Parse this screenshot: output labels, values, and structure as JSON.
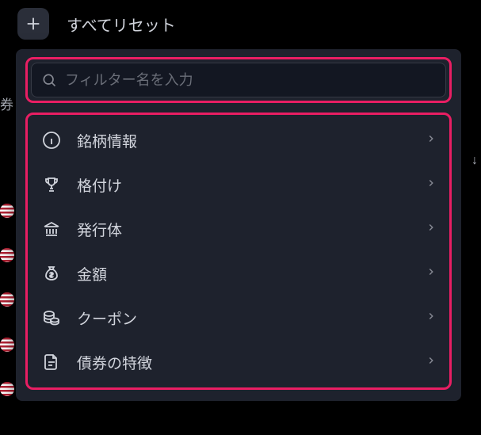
{
  "topbar": {
    "reset_label": "すべてリセット"
  },
  "search": {
    "placeholder": "フィルター名を入力"
  },
  "categories": [
    {
      "icon": "info-icon",
      "label": "銘柄情報"
    },
    {
      "icon": "trophy-icon",
      "label": "格付け"
    },
    {
      "icon": "bank-icon",
      "label": "発行体"
    },
    {
      "icon": "moneybag-icon",
      "label": "金額"
    },
    {
      "icon": "coins-icon",
      "label": "クーポン"
    },
    {
      "icon": "file-icon",
      "label": "債券の特徴"
    }
  ],
  "background": {
    "left_glyph": "券"
  }
}
